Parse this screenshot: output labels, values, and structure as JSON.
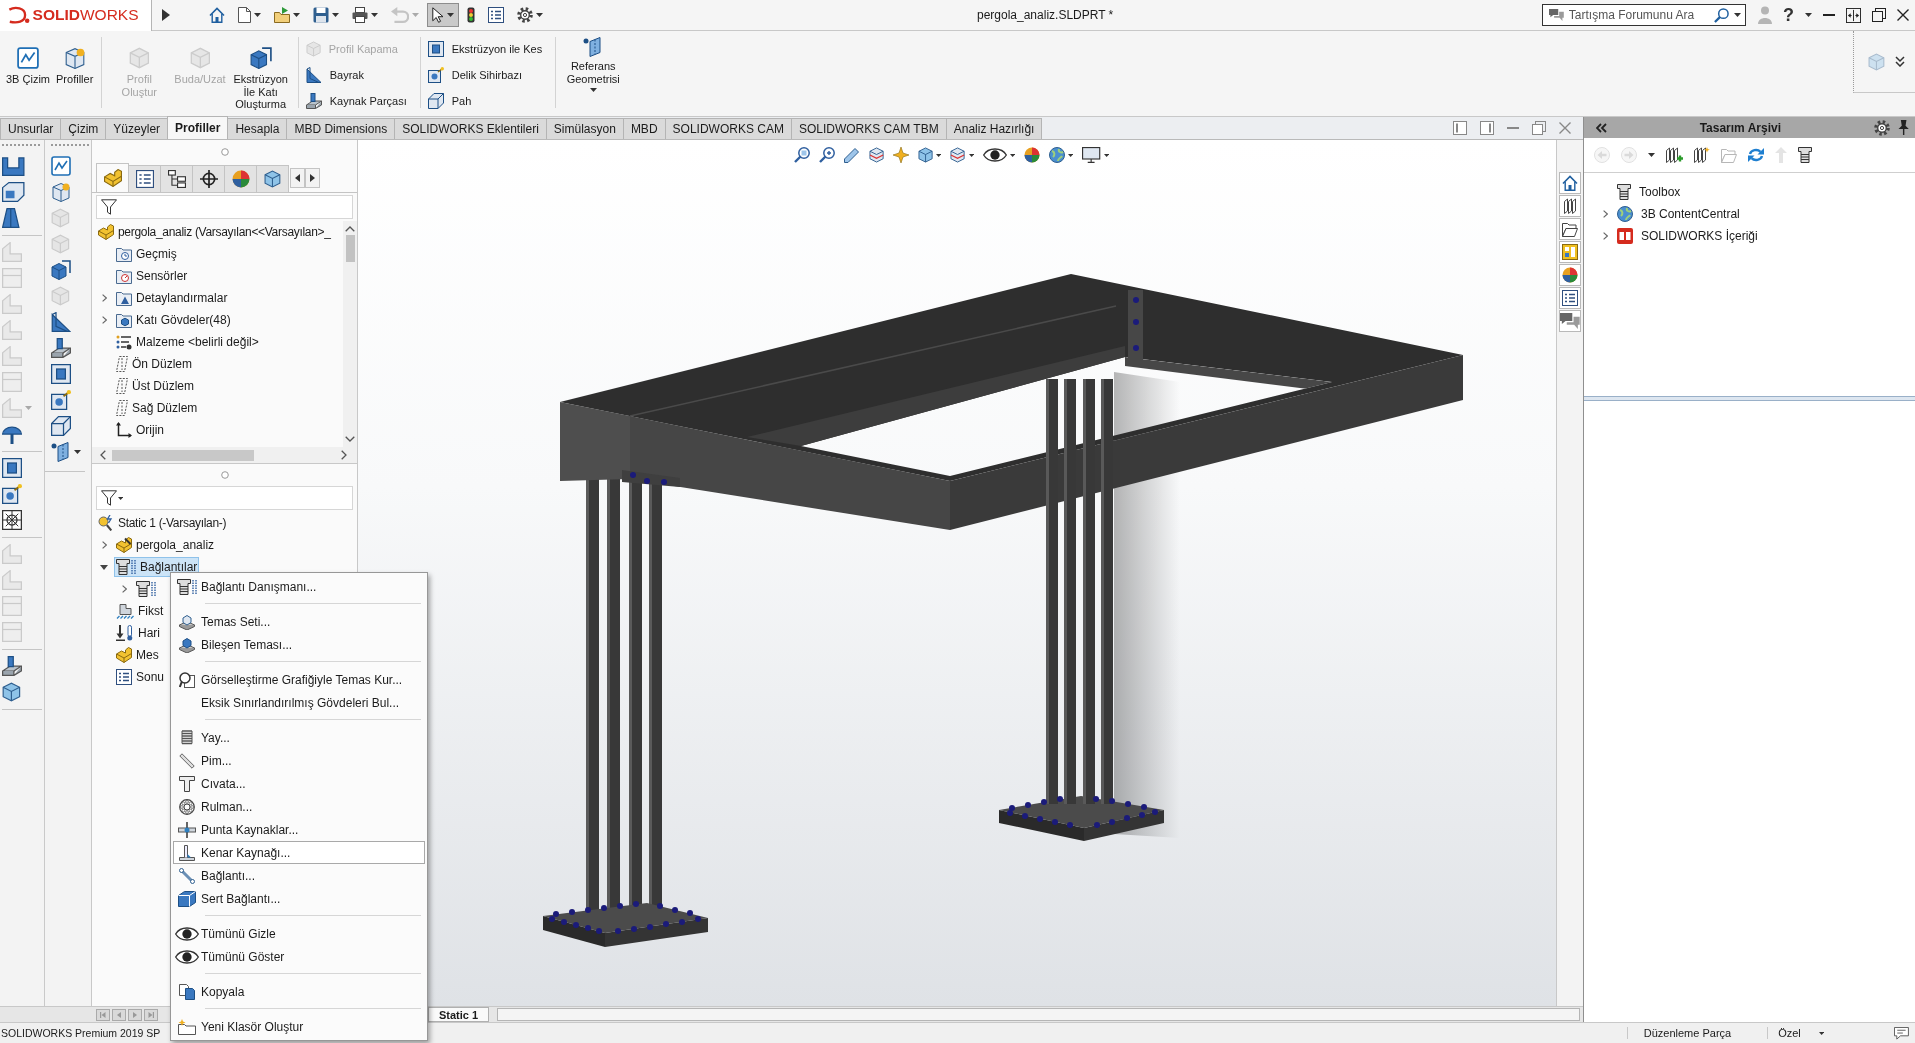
{
  "title_bar": {
    "logo": "**SOLID**WORKS",
    "quick_access": [
      {
        "disabled": false,
        "on": false
      },
      {
        "disabled": false,
        "on": false
      },
      {
        "disabled": false,
        "on": false
      },
      {
        "disabled": false,
        "on": false
      },
      {
        "disabled": false,
        "on": false
      },
      {
        "disabled": true,
        "on": false
      },
      {
        "disabled": false,
        "on": true
      },
      {
        "disabled": false,
        "on": false
      },
      {
        "disabled": false,
        "on": false
      },
      {
        "disabled": false,
        "on": false
      }
    ],
    "title": "pergola_analiz.SLDPRT *",
    "search": {
      "placeholder": "Tartışma Forumunu Ara"
    },
    "help": "?"
  },
  "ribbon": {
    "large_buttons": [
      {
        "label": "3B Çizim",
        "disabled": false
      },
      {
        "label": "Profiller",
        "disabled": false
      },
      {
        "label": "Profil Oluştur",
        "disabled": true
      },
      {
        "label": "Buda/Uzat",
        "disabled": true
      },
      {
        "label": "Ekstrüzyon İle Katı Oluşturma",
        "disabled": false
      }
    ],
    "small_columns": [
      [
        {
          "label": "Profil Kapama",
          "disabled": true
        },
        {
          "label": "Bayrak",
          "disabled": false
        },
        {
          "label": "Kaynak Parçası",
          "disabled": false
        }
      ],
      [
        {
          "label": "Ekstrüzyon ile Kes",
          "disabled": false
        },
        {
          "label": "Delik Sihirbazı",
          "disabled": false
        },
        {
          "label": "Pah",
          "disabled": false
        }
      ]
    ],
    "reference_button": {
      "label": "Referans Geometrisi",
      "disabled": false
    },
    "side_button": {
      "disabled": true
    }
  },
  "tabs": [
    {
      "label": "Unsurlar",
      "selected": false
    },
    {
      "label": "Çizim",
      "selected": false
    },
    {
      "label": "Yüzeyler",
      "selected": false
    },
    {
      "label": "Profiller",
      "selected": true
    },
    {
      "label": "Hesapla",
      "selected": false
    },
    {
      "label": "MBD Dimensions",
      "selected": false
    },
    {
      "label": "SOLIDWORKS Eklentileri",
      "selected": false
    },
    {
      "label": "Simülasyon",
      "selected": false
    },
    {
      "label": "MBD",
      "selected": false
    },
    {
      "label": "SOLIDWORKS CAM",
      "selected": false
    },
    {
      "label": "SOLIDWORKS CAM TBM",
      "selected": false
    },
    {
      "label": "Analiz Hazırlığı",
      "selected": false
    }
  ],
  "command_bar": {
    "column_1": [
      [
        {
          "disabled": false
        },
        {
          "disabled": false
        },
        {
          "disabled": false
        }
      ],
      [
        {
          "disabled": true
        },
        {
          "disabled": true
        },
        {
          "disabled": true
        },
        {
          "disabled": true
        },
        {
          "disabled": true
        },
        {
          "disabled": true
        },
        {
          "disabled": true
        },
        {
          "disabled": false
        }
      ],
      [
        {
          "disabled": false
        },
        {
          "disabled": false
        },
        {
          "disabled": false
        }
      ],
      [
        {
          "disabled": true
        },
        {
          "disabled": true
        },
        {
          "disabled": true
        },
        {
          "disabled": true
        }
      ],
      [
        {
          "disabled": false
        },
        {
          "disabled": false
        }
      ]
    ],
    "column_2": [
      {
        "disabled": false
      },
      {
        "disabled": false
      },
      {
        "disabled": true
      },
      {
        "disabled": true
      },
      {
        "disabled": false
      },
      {
        "disabled": true
      },
      {
        "disabled": false
      },
      {
        "disabled": false
      },
      {
        "disabled": false
      },
      {
        "disabled": false
      },
      {
        "disabled": false
      },
      {
        "disabled": false
      }
    ]
  },
  "feature_tree": {
    "tabs": [
      {
        "selected": true
      },
      {
        "selected": false
      },
      {
        "selected": false
      },
      {
        "selected": false
      },
      {
        "selected": false
      },
      {
        "selected": false
      }
    ],
    "root": {
      "label": "pergola_analiz (Varsayılan<<Varsayılan>_",
      "selected": false,
      "children": [
        {
          "label": "Geçmiş",
          "selected": false
        },
        {
          "label": "Sensörler",
          "selected": false
        },
        {
          "label": "Detaylandırmalar",
          "expanded": false,
          "selected": false
        },
        {
          "label": "Katı Gövdeler(48)",
          "expanded": false,
          "selected": false
        },
        {
          "label": "Malzeme <belirli değil>",
          "selected": false
        },
        {
          "label": "Ön Düzlem",
          "selected": false
        },
        {
          "label": "Üst Düzlem",
          "selected": false
        },
        {
          "label": "Sağ Düzlem",
          "selected": false
        },
        {
          "label": "Orijin",
          "selected": false
        }
      ]
    }
  },
  "simulation_tree": {
    "root": {
      "label": "Static 1 (-Varsayılan-)",
      "selected": false,
      "children": [
        {
          "label": "pergola_analiz",
          "expanded": false,
          "selected": false
        },
        {
          "label": "Bağlantılar",
          "expanded": true,
          "selected": true,
          "children": [
            {
              "expanded": false,
              "selected": false
            }
          ]
        },
        {
          "label": "Fikst",
          "selected": false
        },
        {
          "label": "Hari",
          "selected": false
        },
        {
          "label": "Mes",
          "selected": false
        },
        {
          "label": "Sonu",
          "selected": false
        }
      ]
    }
  },
  "context_menu": {
    "items": [
      {
        "kind": "item",
        "label": "Bağlantı Danışmanı...",
        "selected": false
      },
      {
        "kind": "separator"
      },
      {
        "kind": "item",
        "label": "Temas Seti...",
        "selected": false
      },
      {
        "kind": "item",
        "label": "Bileşen Teması...",
        "selected": false
      },
      {
        "kind": "separator"
      },
      {
        "kind": "item",
        "label": "Görselleştirme Grafiğiyle Temas Kur...",
        "selected": false
      },
      {
        "kind": "item",
        "label": "Eksik Sınırlandırılmış Gövdeleri Bul...",
        "selected": false
      },
      {
        "kind": "separator"
      },
      {
        "kind": "item",
        "label": "Yay...",
        "selected": false
      },
      {
        "kind": "item",
        "label": "Pim...",
        "selected": false
      },
      {
        "kind": "item",
        "label": "Cıvata...",
        "selected": false
      },
      {
        "kind": "item",
        "label": "Rulman...",
        "selected": false
      },
      {
        "kind": "item",
        "label": "Punta Kaynaklar...",
        "selected": false
      },
      {
        "kind": "item",
        "label": "Kenar Kaynağı...",
        "selected": true
      },
      {
        "kind": "item",
        "label": "Bağlantı...",
        "selected": false
      },
      {
        "kind": "item",
        "label": "Sert Bağlantı...",
        "selected": false
      },
      {
        "kind": "separator"
      },
      {
        "kind": "item",
        "label": "Tümünü Gizle",
        "selected": false
      },
      {
        "kind": "item",
        "label": "Tümünü Göster",
        "selected": false
      },
      {
        "kind": "separator"
      },
      {
        "kind": "item",
        "label": "Kopyala",
        "selected": false
      },
      {
        "kind": "separator"
      },
      {
        "kind": "item",
        "label": "Yeni Klasör Oluştur",
        "selected": false
      }
    ]
  },
  "design_library": {
    "title": "Tasarım Arşivi",
    "toolbar": [
      {
        "disabled": true
      },
      {
        "disabled": true
      },
      {
        "disabled": false
      },
      {
        "disabled": false
      },
      {
        "disabled": false
      },
      {
        "disabled": true
      },
      {
        "disabled": false
      },
      {
        "disabled": true
      },
      {
        "disabled": false
      }
    ],
    "items": [
      {
        "label": "Toolbox"
      },
      {
        "label": "3B ContentCentral",
        "expanded": false
      },
      {
        "label": "SOLIDWORKS İçeriği",
        "expanded": false
      }
    ]
  },
  "model_tabs": [
    {
      "label": "Static 1",
      "selected": true
    }
  ],
  "status_bar": {
    "product": "SOLIDWORKS Premium 2019 SP",
    "mode": "Düzenleme Parça",
    "units": "Özel"
  }
}
